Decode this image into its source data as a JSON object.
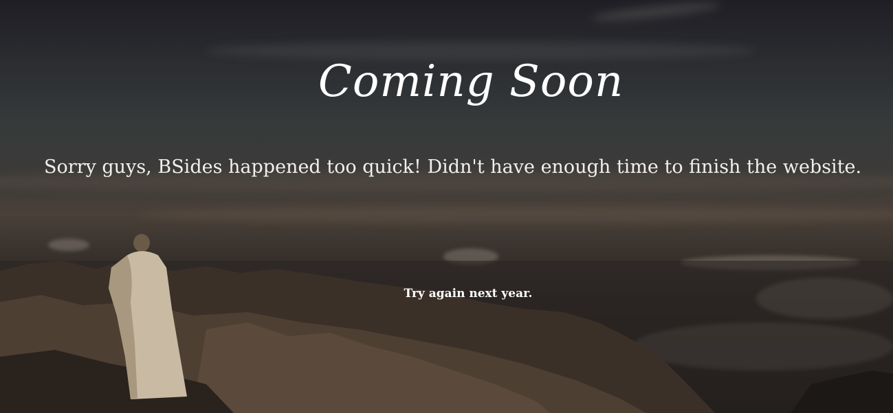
{
  "hero": {
    "title": "Coming Soon",
    "message": "Sorry guys, BSides happened too quick! Didn't have enough time to finish the website.",
    "note": "Try again next year."
  },
  "background": {
    "description_colors": {
      "sky_top": "#1f1e24",
      "horizon": "#4a4038",
      "ground": "#1a1714",
      "rock": "#5a4a3c",
      "cloak": "#c9bba3"
    }
  }
}
